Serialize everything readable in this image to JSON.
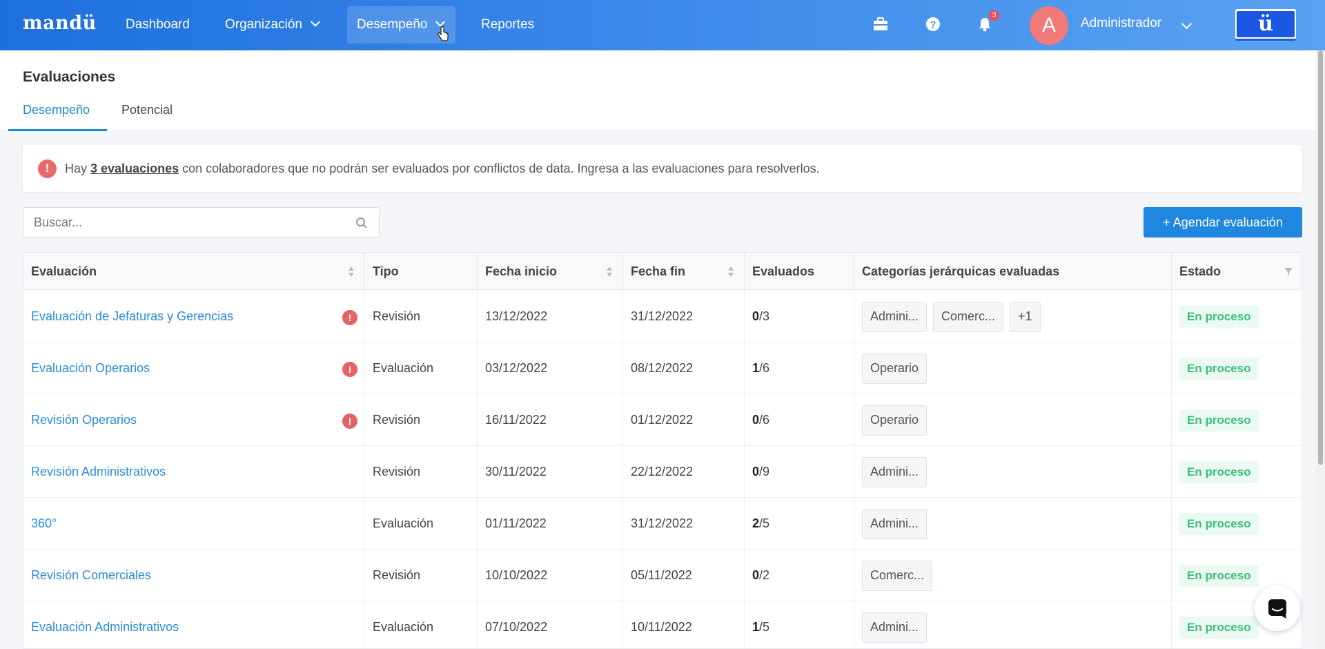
{
  "topbar": {
    "logo": "mandü",
    "nav": [
      {
        "label": "Dashboard"
      },
      {
        "label": "Organización"
      },
      {
        "label": "Desempeño"
      },
      {
        "label": "Reportes"
      }
    ],
    "notifications_count": "3",
    "avatar_letter": "A",
    "user_name": "Administrador",
    "brand_button": "ü"
  },
  "page": {
    "title": "Evaluaciones",
    "tabs": [
      {
        "label": "Desempeño"
      },
      {
        "label": "Potencial"
      }
    ]
  },
  "alert": {
    "prefix": "Hay",
    "link": "3 evaluaciones",
    "suffix": "con colaboradores que no podrán ser evaluados por conflictos de data. Ingresa a las evaluaciones para resolverlos."
  },
  "search": {
    "placeholder": "Buscar..."
  },
  "add_button": "+ Agendar evaluación",
  "table": {
    "headers": [
      "Evaluación",
      "Tipo",
      "Fecha inicio",
      "Fecha fin",
      "Evaluados",
      "Categorías jerárquicas evaluadas",
      "Estado"
    ],
    "rows": [
      {
        "name": "Evaluación de Jefaturas y Gerencias",
        "warning": true,
        "type": "Revisión",
        "start": "13/12/2022",
        "end": "31/12/2022",
        "done": "0",
        "total": "/3",
        "tags": [
          "Admini...",
          "Comerc...",
          "+1"
        ],
        "status": "En proceso"
      },
      {
        "name": "Evaluación Operarios",
        "warning": true,
        "type": "Evaluación",
        "start": "03/12/2022",
        "end": "08/12/2022",
        "done": "1",
        "total": "/6",
        "tags": [
          "Operario"
        ],
        "status": "En proceso"
      },
      {
        "name": "Revisión Operarios",
        "warning": true,
        "type": "Revisión",
        "start": "16/11/2022",
        "end": "01/12/2022",
        "done": "0",
        "total": "/6",
        "tags": [
          "Operario"
        ],
        "status": "En proceso"
      },
      {
        "name": "Revisión Administrativos",
        "warning": false,
        "type": "Revisión",
        "start": "30/11/2022",
        "end": "22/12/2022",
        "done": "0",
        "total": "/9",
        "tags": [
          "Admini..."
        ],
        "status": "En proceso"
      },
      {
        "name": "360°",
        "warning": false,
        "type": "Evaluación",
        "start": "01/11/2022",
        "end": "31/12/2022",
        "done": "2",
        "total": "/5",
        "tags": [
          "Admini..."
        ],
        "status": "En proceso"
      },
      {
        "name": "Revisión Comerciales",
        "warning": false,
        "type": "Revisión",
        "start": "10/10/2022",
        "end": "05/11/2022",
        "done": "0",
        "total": "/2",
        "tags": [
          "Comerc..."
        ],
        "status": "En proceso"
      },
      {
        "name": "Evaluación Administrativos",
        "warning": false,
        "type": "Evaluación",
        "start": "07/10/2022",
        "end": "10/11/2022",
        "done": "1",
        "total": "/5",
        "tags": [
          "Admini..."
        ],
        "status": "En proceso"
      }
    ]
  }
}
